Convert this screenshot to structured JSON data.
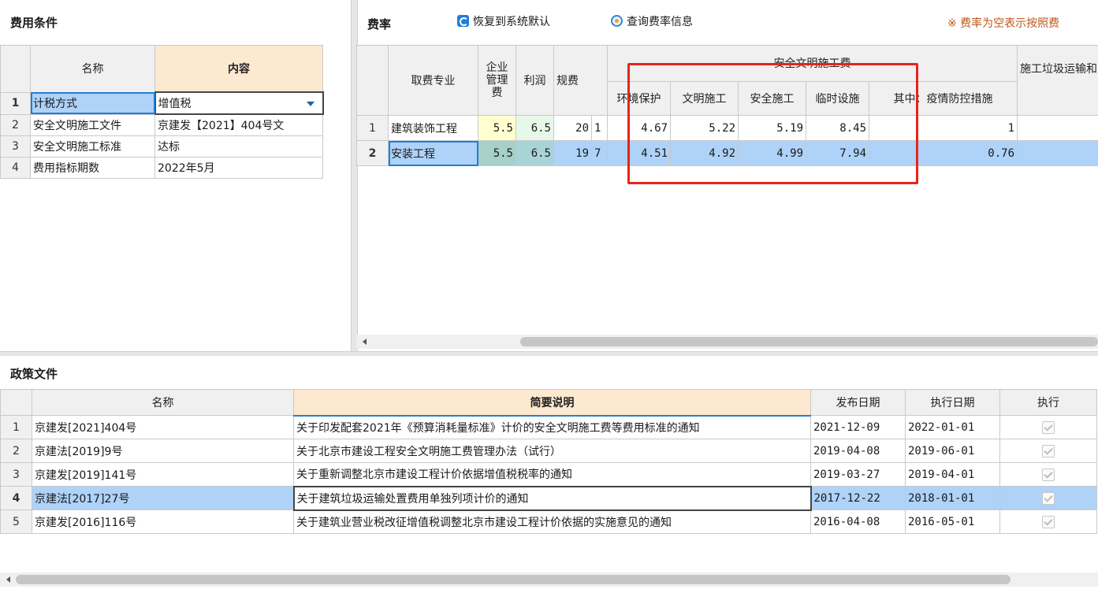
{
  "left_panel": {
    "title": "费用条件",
    "columns": [
      "名称",
      "内容"
    ],
    "rows": [
      {
        "no": "1",
        "name": "计税方式",
        "value": "增值税"
      },
      {
        "no": "2",
        "name": "安全文明施工文件",
        "value": "京建发【2021】404号文"
      },
      {
        "no": "3",
        "name": "安全文明施工标准",
        "value": "达标"
      },
      {
        "no": "4",
        "name": "费用指标期数",
        "value": "2022年5月"
      }
    ]
  },
  "rate_panel": {
    "title": "费率",
    "restore_label": "恢复到系统默认",
    "query_label": "查询费率信息",
    "note": "※ 费率为空表示按照费",
    "columns": {
      "major": "取费专业",
      "mgmt": "企业管理费",
      "profit": "利润",
      "regfee": "规费",
      "safety_group": "安全文明施工费",
      "env": "环境保护",
      "civil": "文明施工",
      "safe": "安全施工",
      "temp": "临时设施",
      "epidemic": "其中：疫情防控措施",
      "waste": "施工垃圾运输和"
    },
    "rows": [
      {
        "no": "1",
        "major": "建筑装饰工程",
        "mgmt": "5.5",
        "profit": "6.5",
        "regfee": "20",
        "regfee_tail": "1",
        "env": "4.67",
        "civil": "5.22",
        "safe": "5.19",
        "temp": "8.45",
        "epidemic": "1"
      },
      {
        "no": "2",
        "major": "安装工程",
        "mgmt": "5.5",
        "profit": "6.5",
        "regfee": "19",
        "regfee_tail": "7",
        "env": "4.51",
        "civil": "4.92",
        "safe": "4.99",
        "temp": "7.94",
        "epidemic": "0.76"
      }
    ]
  },
  "policy_panel": {
    "title": "政策文件",
    "columns": [
      "名称",
      "简要说明",
      "发布日期",
      "执行日期",
      "执行"
    ],
    "rows": [
      {
        "no": "1",
        "name": "京建发[2021]404号",
        "desc": "关于印发配套2021年《预算消耗量标准》计价的安全文明施工费等费用标准的通知",
        "pub": "2021-12-09",
        "exec": "2022-01-01"
      },
      {
        "no": "2",
        "name": "京建法[2019]9号",
        "desc": "关于北京市建设工程安全文明施工费管理办法（试行）",
        "pub": "2019-04-08",
        "exec": "2019-06-01"
      },
      {
        "no": "3",
        "name": "京建发[2019]141号",
        "desc": "关于重新调整北京市建设工程计价依据增值税税率的通知",
        "pub": "2019-03-27",
        "exec": "2019-04-01"
      },
      {
        "no": "4",
        "name": "京建法[2017]27号",
        "desc": "关于建筑垃圾运输处置费用单独列项计价的通知",
        "pub": "2017-12-22",
        "exec": "2018-01-01"
      },
      {
        "no": "5",
        "name": "京建发[2016]116号",
        "desc": "关于建筑业营业税改征增值税调整北京市建设工程计价依据的实施意见的通知",
        "pub": "2016-04-08",
        "exec": "2016-05-01"
      }
    ]
  },
  "colors": {
    "selection": "#aed2f8",
    "header_orange": "#fde9cf",
    "highlight_red": "#e8231a",
    "accent_blue": "#1e7fd8"
  }
}
